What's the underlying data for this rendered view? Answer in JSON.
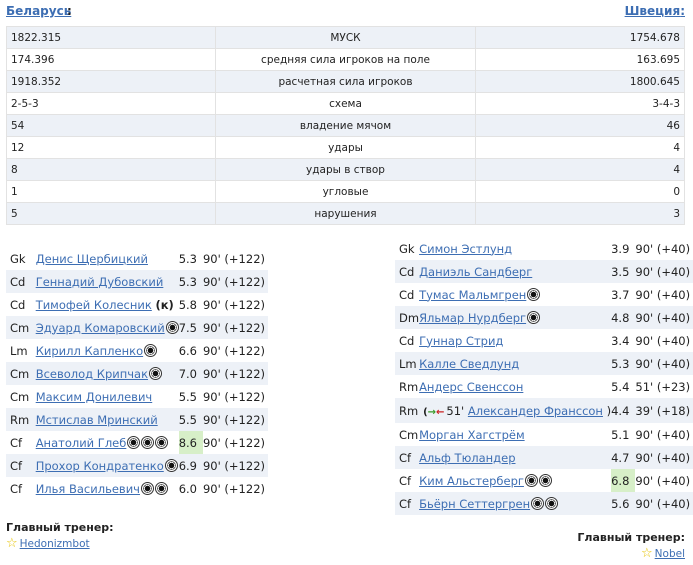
{
  "teams": {
    "left": "Беларусь",
    "right": "Швеция"
  },
  "stats": [
    {
      "left": "1822.315",
      "label": "МУСК",
      "right": "1754.678"
    },
    {
      "left": "174.396",
      "label": "средняя сила игроков на поле",
      "right": "163.695"
    },
    {
      "left": "1918.352",
      "label": "расчетная сила игроков",
      "right": "1800.645"
    },
    {
      "left": "2-5-3",
      "label": "схема",
      "right": "3-4-3"
    },
    {
      "left": "54",
      "label": "владение мячом",
      "right": "46"
    },
    {
      "left": "12",
      "label": "удары",
      "right": "4"
    },
    {
      "left": "8",
      "label": "удары в створ",
      "right": "4"
    },
    {
      "left": "1",
      "label": "угловые",
      "right": "0"
    },
    {
      "left": "5",
      "label": "нарушения",
      "right": "3"
    }
  ],
  "lineup_left": [
    {
      "pos": "Gk",
      "name": "Денис Щербицкий",
      "goals": 0,
      "rating": "5.3",
      "time": "90' (+122)"
    },
    {
      "pos": "Cd",
      "name": "Геннадий Дубовский",
      "goals": 0,
      "rating": "5.3",
      "time": "90' (+122)"
    },
    {
      "pos": "Cd",
      "name": "Тимофей Колесник",
      "captain": "(к)",
      "goals": 0,
      "rating": "5.8",
      "time": "90' (+122)"
    },
    {
      "pos": "Cm",
      "name": "Эдуард Комаровский",
      "goals": 1,
      "rating": "7.5",
      "time": "90' (+122)"
    },
    {
      "pos": "Lm",
      "name": "Кирилл Капленко",
      "goals": 1,
      "rating": "6.6",
      "time": "90' (+122)"
    },
    {
      "pos": "Cm",
      "name": "Всеволод Крипчак",
      "goals": 1,
      "rating": "7.0",
      "time": "90' (+122)"
    },
    {
      "pos": "Cm",
      "name": "Максим Донилевич",
      "goals": 0,
      "rating": "5.5",
      "time": "90' (+122)"
    },
    {
      "pos": "Rm",
      "name": "Мстислав Мринский",
      "goals": 0,
      "rating": "5.5",
      "time": "90' (+122)"
    },
    {
      "pos": "Cf",
      "name": "Анатолий Глеб",
      "goals": 3,
      "rating": "8.6",
      "highlight": true,
      "time": "90' (+122)"
    },
    {
      "pos": "Cf",
      "name": "Прохор Кондратенко",
      "goals": 1,
      "rating": "6.9",
      "time": "90' (+122)"
    },
    {
      "pos": "Cf",
      "name": "Илья Васильевич",
      "goals": 2,
      "rating": "6.0",
      "time": "90' (+122)"
    }
  ],
  "lineup_right": [
    {
      "pos": "Gk",
      "name": "Симон Эстлунд",
      "goals": 0,
      "rating": "3.9",
      "time": "90' (+40)"
    },
    {
      "pos": "Cd",
      "name": "Даниэль Сандберг",
      "goals": 0,
      "rating": "3.5",
      "time": "90' (+40)"
    },
    {
      "pos": "Cd",
      "name": "Тумас Мальмгрен",
      "goals": 1,
      "rating": "3.7",
      "time": "90' (+40)"
    },
    {
      "pos": "Dm",
      "name": "Яльмар Нурдберг",
      "goals": 1,
      "rating": "4.8",
      "time": "90' (+40)"
    },
    {
      "pos": "Cd",
      "name": "Гуннар Стрид",
      "goals": 0,
      "rating": "3.4",
      "time": "90' (+40)"
    },
    {
      "pos": "Lm",
      "name": "Калле Сведлунд",
      "goals": 0,
      "rating": "5.3",
      "time": "90' (+40)"
    },
    {
      "pos": "Rm",
      "name": "Андерс Свенссон",
      "goals": 0,
      "rating": "5.4",
      "time": "51' (+23)"
    },
    {
      "pos": "Rm",
      "name": "Александер Франссон",
      "sub_minute": "51'",
      "goals": 0,
      "rating": "4.4",
      "time": "39' (+18)"
    },
    {
      "pos": "Cm",
      "name": "Морган Хагстрём",
      "goals": 0,
      "rating": "5.1",
      "time": "90' (+40)"
    },
    {
      "pos": "Cf",
      "name": "Альф Тюландер",
      "goals": 0,
      "rating": "4.7",
      "time": "90' (+40)"
    },
    {
      "pos": "Cf",
      "name": "Ким Альстерберг",
      "goals": 2,
      "rating": "6.8",
      "highlight": true,
      "time": "90' (+40)"
    },
    {
      "pos": "Cf",
      "name": "Бьёрн Сеттергрен",
      "goals": 2,
      "rating": "5.6",
      "time": "90' (+40)"
    }
  ],
  "coach": {
    "label": "Главный тренер:",
    "left": "Hedonizmbot",
    "right": "Nobel"
  },
  "icons": {
    "goal": "soccer-ball-icon",
    "coach": "star-icon",
    "substitution": "substitution-arrows-icon"
  },
  "colors": {
    "link": "#3d6eb3",
    "row_alt": "#edf1f7",
    "rating_highlight": "#d7efc8"
  }
}
